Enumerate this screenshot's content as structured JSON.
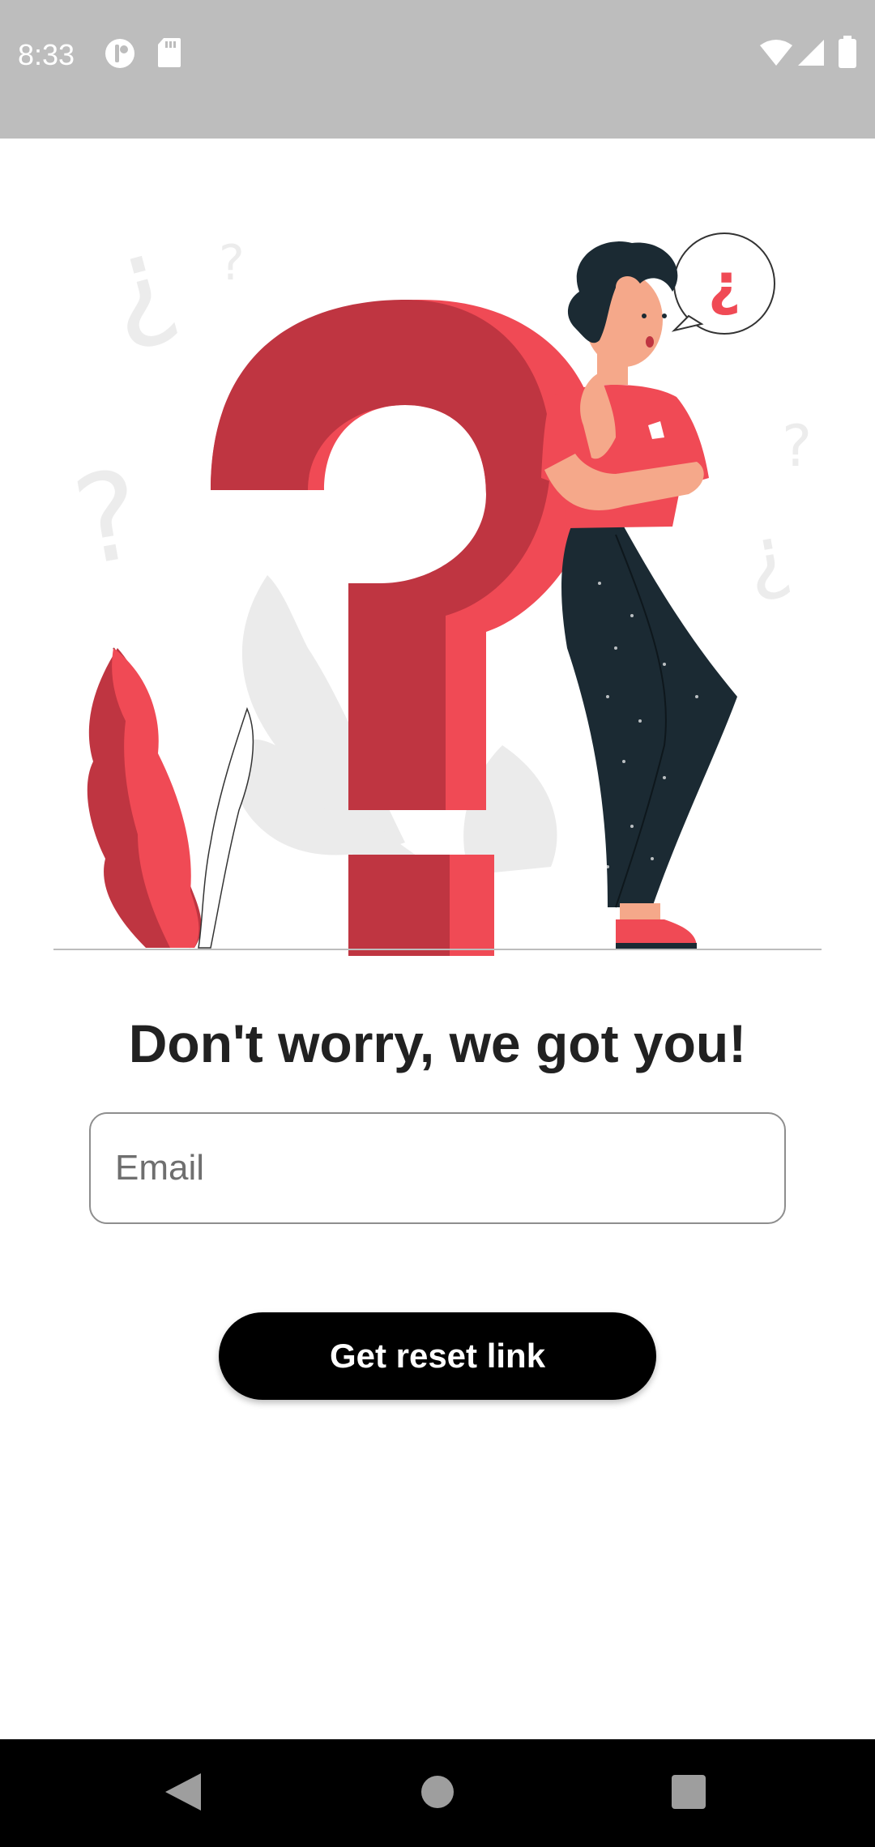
{
  "status_bar": {
    "time": "8:33",
    "icons_left": [
      "notification-app-icon",
      "sd-card-icon"
    ],
    "icons_right": [
      "wifi-icon",
      "cellular-signal-icon",
      "battery-icon"
    ]
  },
  "illustration": {
    "name": "confused-person-question-mark",
    "speech_bubble_glyph": "¿",
    "colors": {
      "accent": "#f04a55",
      "accent_dark": "#bf3541",
      "pants": "#1b2a33",
      "leaf_gray": "#ebebeb"
    }
  },
  "headline": "Don't worry, we got you!",
  "email": {
    "placeholder": "Email",
    "value": ""
  },
  "reset_button": {
    "label": "Get reset link",
    "color": "#000000"
  },
  "nav_bar": {
    "buttons": [
      "back-icon",
      "home-icon",
      "recents-icon"
    ]
  }
}
